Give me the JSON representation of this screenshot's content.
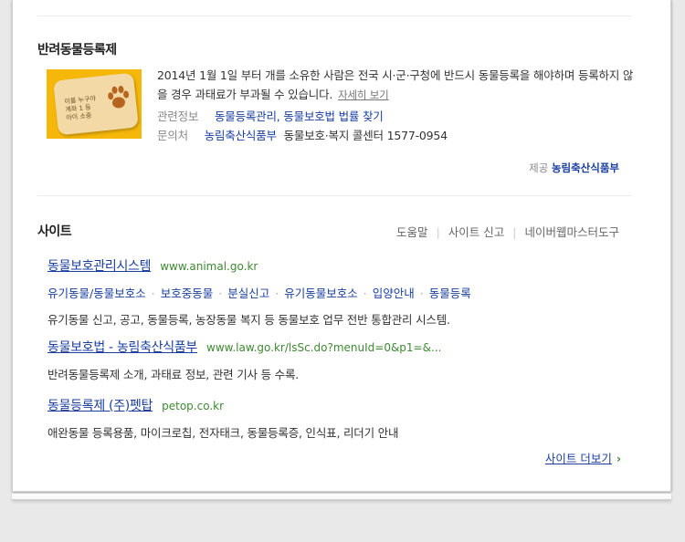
{
  "pet_registration": {
    "title": "반려동물등록제",
    "card_text": [
      "이름 누구야",
      "계좌 1 등",
      "아이 소중"
    ],
    "description": "2014년 1월 1일 부터 개를 소유한 사람은 전국 시·군·구청에 반드시 동물등록을 해야하며 등록하지 않을 경우 과태료가 부과될 수 있습니다.",
    "detail_link": "자세히 보기",
    "related_label": "관련정보",
    "related_links": [
      "동물등록관리,",
      "동물보호법 법률 찾기"
    ],
    "contact_label": "문의처",
    "contact_org": "농림축산식품부",
    "contact_info": "동물보호·복지 콜센터 1577-0954",
    "provider_label": "제공",
    "provider_name": "농림축산식품부"
  },
  "site_section": {
    "title": "사이트",
    "tools": [
      "도움말",
      "사이트 신고",
      "네이버웹마스터도구"
    ],
    "results": [
      {
        "title": "동물보호관리시스템",
        "url": "www.animal.go.kr",
        "sublinks": [
          "유기동물/동물보호소",
          "보호중동물",
          "분실신고",
          "유기동물보호소",
          "입양안내",
          "동물등록"
        ],
        "desc": "유기동물 신고, 공고, 동물등록, 농장동물 복지 등 동물보호 업무 전반 통합관리 시스템."
      },
      {
        "title": "동물보호법 - 농림축산식품부",
        "url": "www.law.go.kr/lsSc.do?menuId=0&p1=&...",
        "desc": "반려동물등록제 소개, 과태료 정보, 관련 기사 등 수록."
      },
      {
        "title": "동물등록제 (주)펫탑",
        "url": "petop.co.kr",
        "desc": "애완동물 등록용품, 마이크로칩, 전자태크, 동물등록증, 인식표, 리더기 안내"
      }
    ],
    "see_more": "사이트 더보기",
    "see_more_arrow": "›"
  },
  "colors": {
    "link": "#1a3fa1",
    "url_green": "#3e8a32",
    "thumb_bg": "#f5b80a"
  }
}
